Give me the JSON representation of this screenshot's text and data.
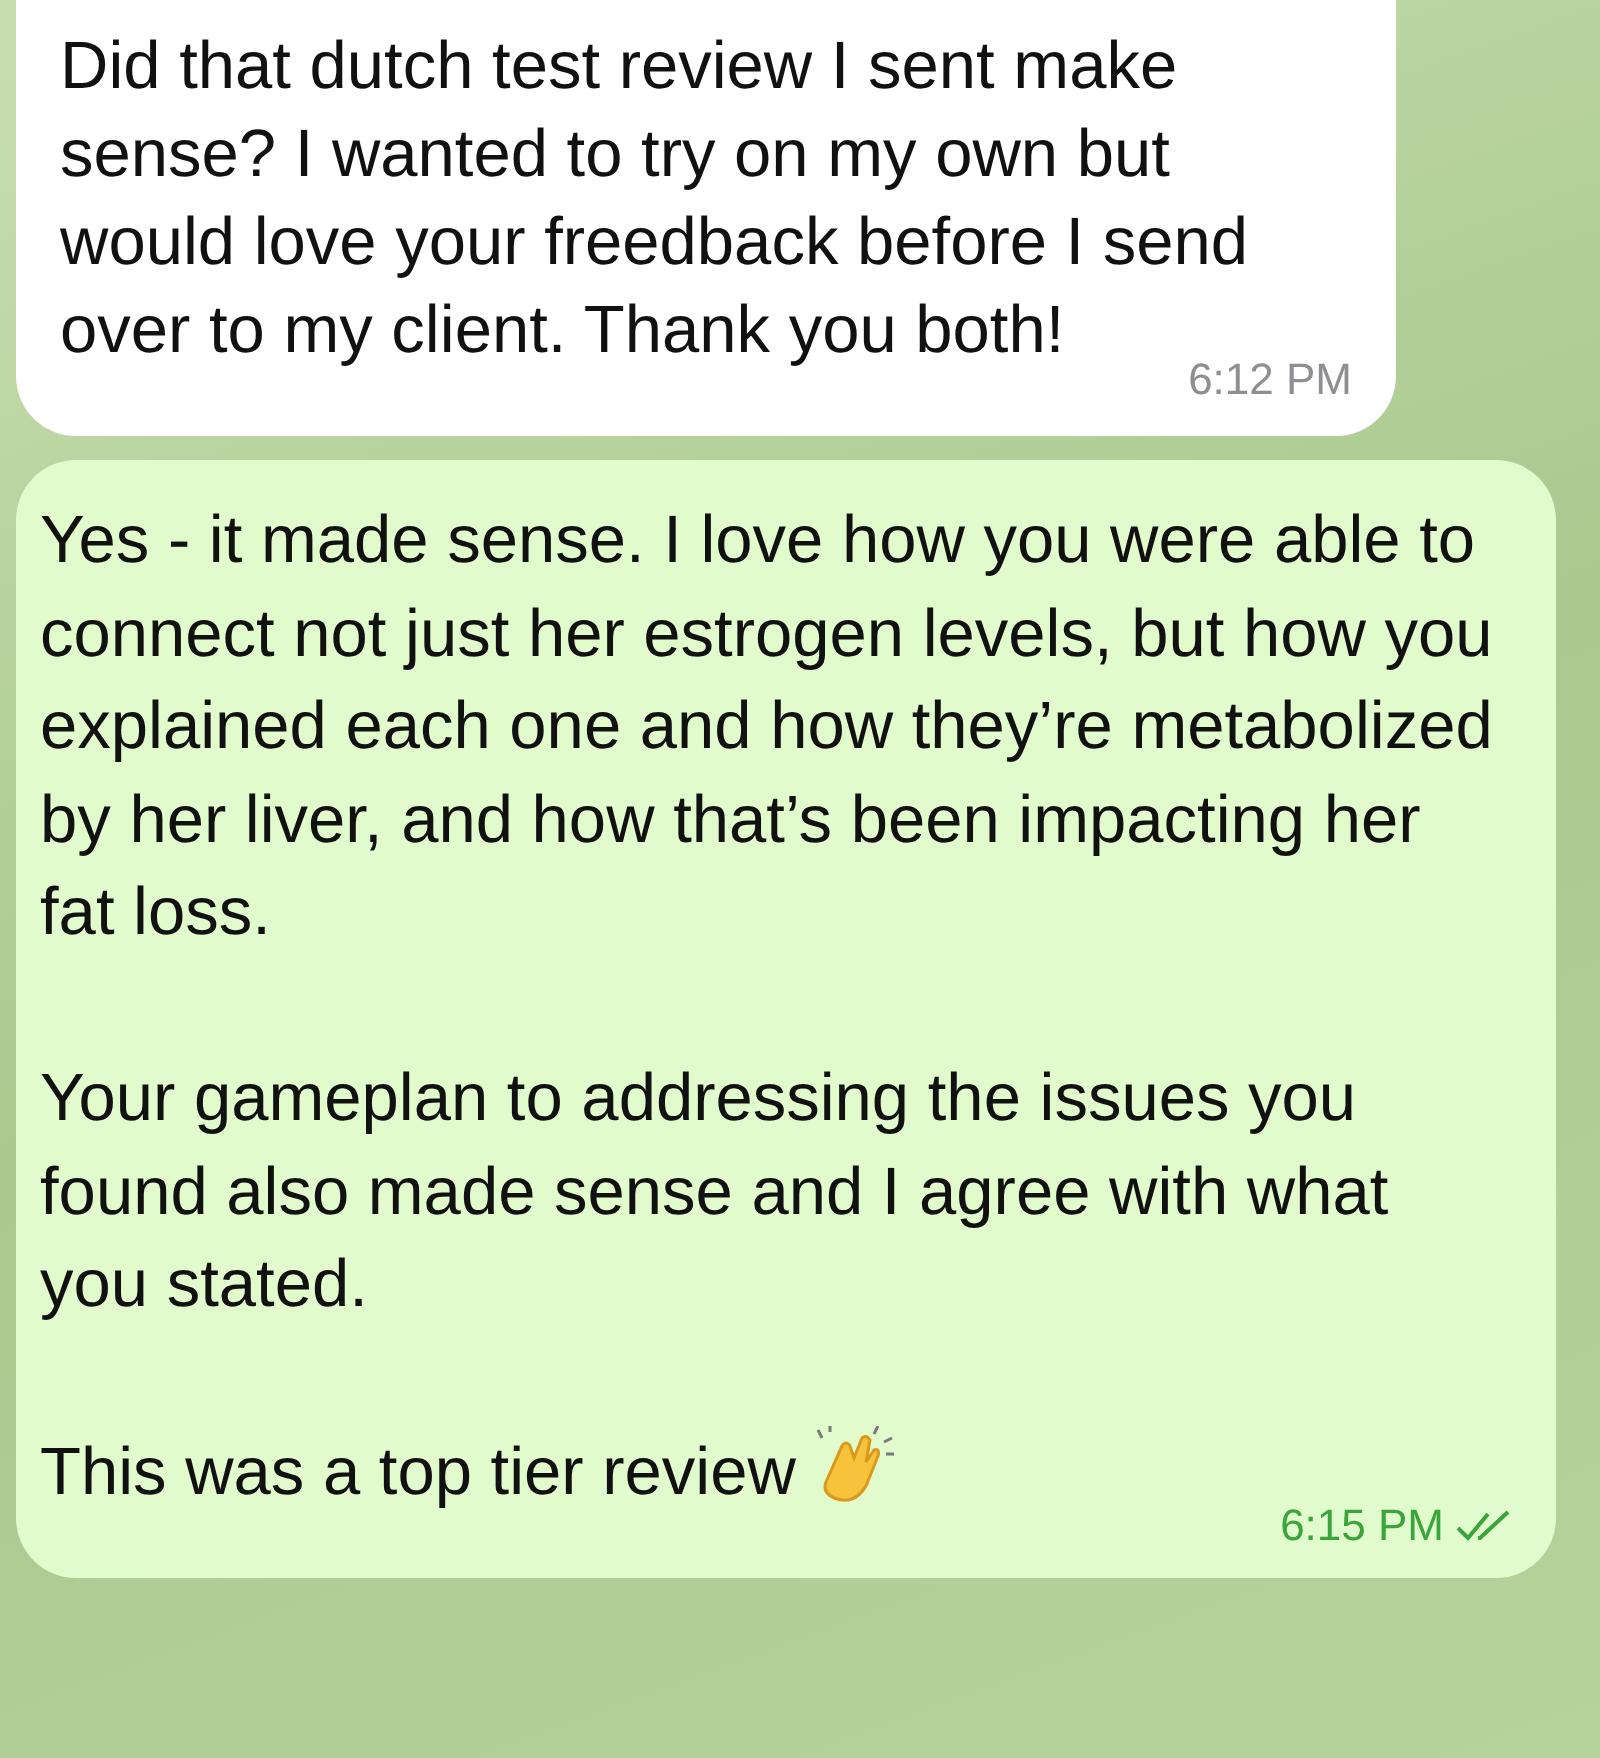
{
  "messages": [
    {
      "kind": "incoming",
      "paragraphs": [
        "Did that dutch test review I sent make sense? I wanted to try on my own but would love your freedback before I send over to my client. Thank you both!"
      ],
      "has_emoji": false,
      "time": "6:12 PM",
      "read": false
    },
    {
      "kind": "outgoing",
      "paragraphs": [
        "Yes - it made sense. I love how you were able to connect not just her estrogen levels, but how you explained each one and how they’re metabolized by her liver, and how that’s been impacting her fat loss.",
        "Your gameplan to addressing the issues you found also made sense and I agree with what you stated.",
        "This was a top tier review"
      ],
      "has_emoji": true,
      "time": "6:15 PM",
      "read": true
    }
  ]
}
